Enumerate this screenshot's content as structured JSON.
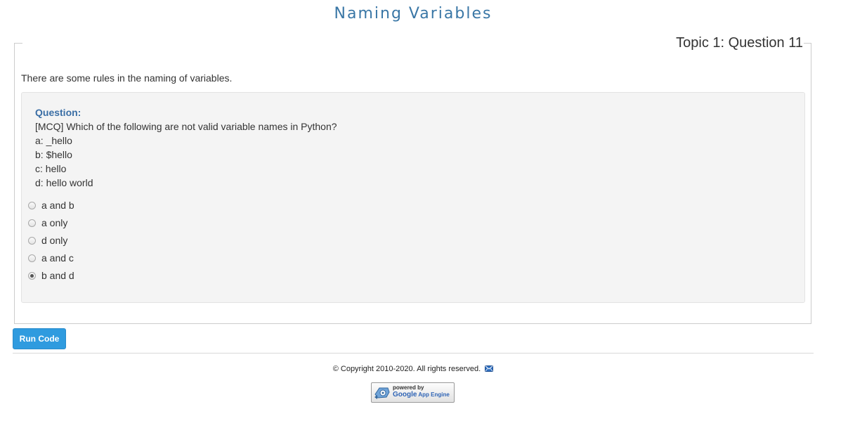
{
  "header": {
    "title": "Naming Variables"
  },
  "panel": {
    "legend": "Topic 1: Question 11",
    "intro": "There are some rules in the naming of variables.",
    "question": {
      "heading": "Question:",
      "lines": [
        "[MCQ] Which of the following are not valid variable names in Python?",
        "a: _hello",
        "b: $hello",
        "c: hello",
        "d: hello world"
      ],
      "options": [
        {
          "label": "a and b",
          "checked": false
        },
        {
          "label": "a only",
          "checked": false
        },
        {
          "label": "d only",
          "checked": false
        },
        {
          "label": "a and c",
          "checked": false
        },
        {
          "label": "b and d",
          "checked": true
        }
      ]
    }
  },
  "actions": {
    "run_label": "Run Code"
  },
  "footer": {
    "copyright": "© Copyright 2010-2020. All rights reserved.",
    "badge_small": "powered by",
    "badge_google": "Google",
    "badge_app": " App Engine"
  },
  "colors": {
    "title": "#3a77a6",
    "accent_button": "#2f9bdf",
    "question_heading": "#3a6ea5"
  },
  "icons": {
    "mail": "mail-icon",
    "badge_logo": "app-engine-logo-icon"
  }
}
